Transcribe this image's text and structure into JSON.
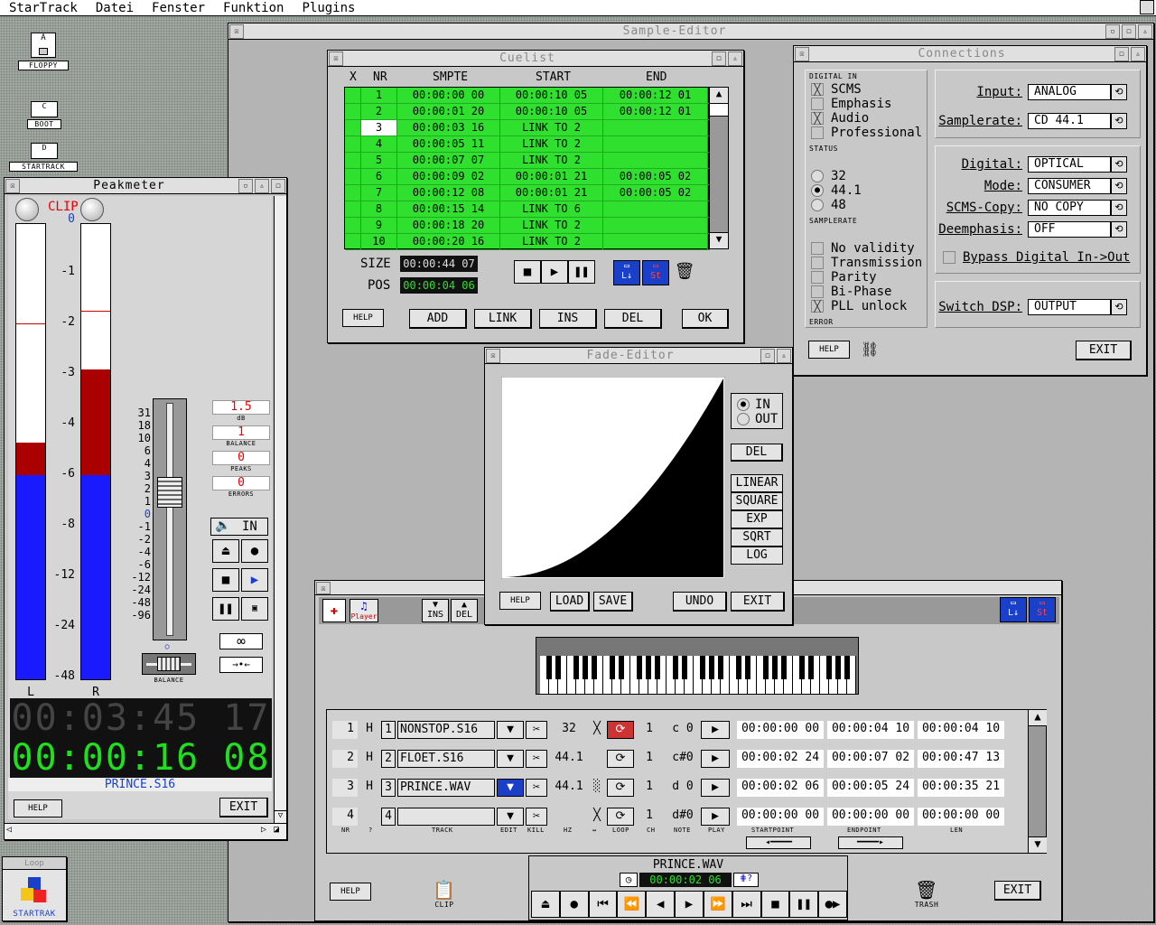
{
  "menubar": {
    "items": [
      "StarTrack",
      "Datei",
      "Fenster",
      "Funktion",
      "Plugins"
    ]
  },
  "desktop": {
    "icons": [
      {
        "label": "FLOPPY",
        "glyph": "A"
      },
      {
        "label": "BOOT",
        "glyph": "C"
      },
      {
        "label": "STARTRACK",
        "glyph": "D"
      }
    ]
  },
  "sample_editor": {
    "title": "Sample-Editor"
  },
  "cuelist": {
    "title": "Cuelist",
    "headers": {
      "x": "X",
      "nr": "NR",
      "smpte": "SMPTE",
      "start": "START",
      "end": "END"
    },
    "rows": [
      {
        "nr": "1",
        "smpte": "00:00:00 00",
        "start": "00:00:10 05",
        "end": "00:00:12 01"
      },
      {
        "nr": "2",
        "smpte": "00:00:01 20",
        "start": "00:00:10 05",
        "end": "00:00:12 01"
      },
      {
        "nr": "3",
        "smpte": "00:00:03 16",
        "start": "LINK TO 2",
        "end": ""
      },
      {
        "nr": "4",
        "smpte": "00:00:05 11",
        "start": "LINK TO 2",
        "end": ""
      },
      {
        "nr": "5",
        "smpte": "00:00:07 07",
        "start": "LINK TO 2",
        "end": ""
      },
      {
        "nr": "6",
        "smpte": "00:00:09 02",
        "start": "00:00:01 21",
        "end": "00:00:05 02"
      },
      {
        "nr": "7",
        "smpte": "00:00:12 08",
        "start": "00:00:01 21",
        "end": "00:00:05 02"
      },
      {
        "nr": "8",
        "smpte": "00:00:15 14",
        "start": "LINK TO 6",
        "end": ""
      },
      {
        "nr": "9",
        "smpte": "00:00:18 20",
        "start": "LINK TO 2",
        "end": ""
      },
      {
        "nr": "10",
        "smpte": "00:00:20 16",
        "start": "LINK TO 2",
        "end": ""
      }
    ],
    "size_label": "SIZE",
    "size_value": "00:00:44 07",
    "pos_label": "POS",
    "pos_value": "00:00:04 06",
    "help": "HELP",
    "add": "ADD",
    "link": "LINK",
    "ins": "INS",
    "del": "DEL",
    "ok": "OK",
    "load_icon_label": "L",
    "save_icon_label": "St"
  },
  "connections": {
    "title": "Connections",
    "digital_in_label": "DIGITAL IN",
    "digital_in": [
      {
        "label": "SCMS",
        "checked": true
      },
      {
        "label": "Emphasis",
        "checked": false
      },
      {
        "label": "Audio",
        "checked": true
      },
      {
        "label": "Professional",
        "checked": false
      }
    ],
    "status_label": "STATUS",
    "rates": [
      {
        "label": "32",
        "selected": false
      },
      {
        "label": "44.1",
        "selected": true
      },
      {
        "label": "48",
        "selected": false
      }
    ],
    "samplerate_small": "SAMPLERATE",
    "errors": [
      {
        "label": "No validity",
        "checked": false
      },
      {
        "label": "Transmission",
        "checked": false
      },
      {
        "label": "Parity",
        "checked": false
      },
      {
        "label": "Bi-Phase",
        "checked": false
      },
      {
        "label": "PLL unlock",
        "checked": true
      }
    ],
    "error_label": "ERROR",
    "input_label": "Input:",
    "input_value": "ANALOG",
    "samplerate_label": "Samplerate:",
    "samplerate_value": "CD  44.1",
    "digital_label": "Digital:",
    "digital_value": "OPTICAL",
    "mode_label": "Mode:",
    "mode_value": "CONSUMER",
    "scms_label": "SCMS-Copy:",
    "scms_value": "NO COPY",
    "deemph_label": "Deemphasis:",
    "deemph_value": "OFF",
    "bypass_label": "Bypass Digital In->Out",
    "dsp_label": "Switch DSP:",
    "dsp_value": "OUTPUT",
    "help": "HELP",
    "exit": "EXIT"
  },
  "peakmeter": {
    "title": "Peakmeter",
    "clip": "CLIP",
    "scale": [
      "0",
      "-1",
      "-2",
      "-3",
      "-4",
      "-6",
      "-8",
      "-12",
      "-24",
      "-48"
    ],
    "left_label": "L",
    "right_label": "R",
    "left_level": 0.52,
    "right_level": 0.68,
    "fader_scale": [
      "31",
      "18",
      "10",
      "6",
      "4",
      "3",
      "2",
      "1",
      "0",
      "-1",
      "-2",
      "-4",
      "-6",
      "-12",
      "-24",
      "-48",
      "-96"
    ],
    "db_value": "1.5",
    "db_unit": "dB",
    "balance_value": "1",
    "balance_label": "BALANCE",
    "peaks_value": "0",
    "peaks_label": "PEAKS",
    "errors_value": "0",
    "errors_label": "ERRORS",
    "in_label": "IN",
    "balance_small": "BALANCE",
    "time_total": "00:03:45 17",
    "time_pos": "00:00:16 08",
    "filename": "PRINCE.S16",
    "help": "HELP",
    "exit": "EXIT"
  },
  "fade_editor": {
    "title": "Fade-Editor",
    "in": "IN",
    "out": "OUT",
    "del": "DEL",
    "curves": [
      "LINEAR",
      "SQUARE",
      "EXP",
      "SQRT",
      "LOG"
    ],
    "help": "HELP",
    "load": "LOAD",
    "save": "SAVE",
    "undo": "UNDO",
    "exit": "EXIT"
  },
  "tracks": {
    "ins": "INS",
    "del": "DEL",
    "player_label": "Player",
    "rows": [
      {
        "nr": "1",
        "h": "H",
        "num": "1",
        "name": "NONSTOP.S16",
        "hz": "32",
        "ch": "1",
        "note": "c 0",
        "start": "00:00:00 00",
        "end": "00:00:04 10",
        "len": "00:00:04 10"
      },
      {
        "nr": "2",
        "h": "H",
        "num": "2",
        "name": "FLOET.S16",
        "hz": "44.1",
        "ch": "1",
        "note": "c#0",
        "start": "00:00:02 24",
        "end": "00:00:07 02",
        "len": "00:00:47 13"
      },
      {
        "nr": "3",
        "h": "H",
        "num": "3",
        "name": "PRINCE.WAV",
        "hz": "44.1",
        "ch": "1",
        "note": "d 0",
        "start": "00:00:02 06",
        "end": "00:00:05 24",
        "len": "00:00:35 21"
      },
      {
        "nr": "4",
        "h": "",
        "num": "4",
        "name": "",
        "hz": "",
        "ch": "1",
        "note": "d#0",
        "start": "00:00:00 00",
        "end": "00:00:00 00",
        "len": "00:00:00 00"
      }
    ],
    "col_labels": {
      "nr": "NR",
      "q": "?",
      "track": "TRACK",
      "edit": "EDIT",
      "kill": "KILL",
      "hz": "HZ",
      "arrow": "↔",
      "loop": "LOOP",
      "ch": "CH",
      "note": "NOTE",
      "play": "PLAY",
      "start": "STARTPOINT",
      "end": "ENDPOINT",
      "len": "LEN"
    },
    "transport_file": "PRINCE.WAV",
    "transport_time": "00:00:02 06",
    "help": "HELP",
    "clip": "CLIP",
    "trash": "TRASH",
    "exit": "EXIT"
  },
  "loop_window": {
    "title": "Loop",
    "label": "STARTRAK"
  }
}
